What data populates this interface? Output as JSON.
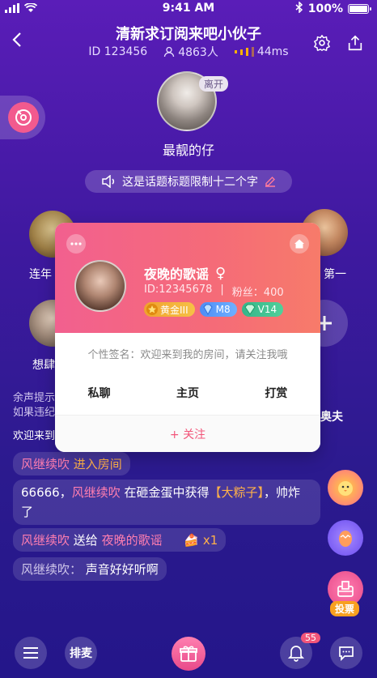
{
  "status_bar": {
    "time": "9:41 AM",
    "battery": "100%"
  },
  "room": {
    "title": "清新求订阅来吧小伙子",
    "id": "ID 123456",
    "online": "4863人",
    "latency": "44ms"
  },
  "host": {
    "name": "最靓的仔",
    "badge": "离开"
  },
  "topic": {
    "text": "这是话题标题限制十二个字"
  },
  "seats": [
    {
      "label": "连年"
    },
    {
      "label": "第一"
    },
    {
      "label": "想肆"
    }
  ],
  "card": {
    "name": "夜晚的歌谣",
    "gender_symbol": "♀",
    "id_text": "ID:12345678",
    "separator": "|",
    "fans_text": "粉丝：400",
    "badges": {
      "gold": "黄金III",
      "blue": "M8",
      "green": "V14"
    },
    "signature": "个性签名：欢迎来到我的房间，请关注我哦",
    "actions": {
      "message": "私聊",
      "home": "主页",
      "tip": "打赏"
    },
    "follow": "+ 关注"
  },
  "chat": {
    "system_line1": "余声提示",
    "system_line2": "如果违纪",
    "welcome": "欢迎来到",
    "right_name": "奥夫",
    "enter_user": "风继续吹",
    "enter_text": "进入房间",
    "gift_msg_prefix": "66666，",
    "gift_msg_user": "风继续吹",
    "gift_msg_mid": "在砸金蛋中获得",
    "gift_msg_item": "【大粽子】",
    "gift_msg_suffix": "，帅炸了",
    "send_user": "风继续吹",
    "send_verb": "送给",
    "send_target": "夜晚的歌谣",
    "send_count": "x1",
    "speak_user": "风继续吹：",
    "speak_text": "声音好好听啊"
  },
  "floats": {
    "vote": "投票"
  },
  "bottom": {
    "queue": "排麦",
    "notif_count": "55"
  }
}
